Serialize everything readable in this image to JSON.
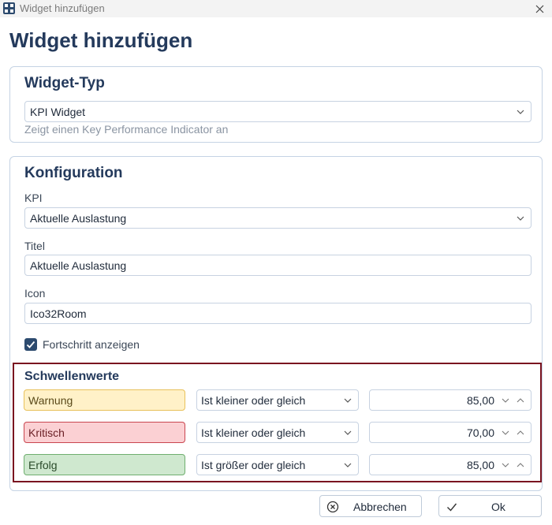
{
  "window": {
    "title": "Widget hinzufügen"
  },
  "heading": "Widget hinzufügen",
  "widget_type": {
    "title": "Widget-Typ",
    "selected": "KPI Widget",
    "hint": "Zeigt einen Key Performance Indicator an"
  },
  "config": {
    "title": "Konfiguration",
    "kpi_label": "KPI",
    "kpi_value": "Aktuelle Auslastung",
    "title_label": "Titel",
    "title_value": "Aktuelle Auslastung",
    "icon_label": "Icon",
    "icon_value": "Ico32Room",
    "progress_label": "Fortschritt anzeigen",
    "progress_checked": true
  },
  "thresholds": {
    "title": "Schwellenwerte",
    "rows": [
      {
        "name": "Warnung",
        "operator": "Ist kleiner oder gleich",
        "value": "85,00",
        "color": "#fff1c8"
      },
      {
        "name": "Kritisch",
        "operator": "Ist kleiner oder gleich",
        "value": "70,00",
        "color": "#fbd0d3"
      },
      {
        "name": "Erfolg",
        "operator": "Ist größer oder gleich",
        "value": "85,00",
        "color": "#cfe8cf"
      }
    ]
  },
  "buttons": {
    "cancel": "Abbrechen",
    "ok": "Ok"
  },
  "icons": {
    "app": "app-grid-icon",
    "close": "close-icon",
    "dropdown": "chevron-down-icon",
    "spin_up": "chevron-up-icon",
    "cancel": "cancel-circle-icon",
    "ok": "checkmark-icon"
  }
}
